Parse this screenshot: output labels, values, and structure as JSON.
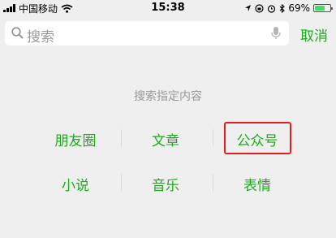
{
  "status_bar": {
    "carrier": "中国移动",
    "time": "15:38",
    "battery_percent": "69%",
    "battery_level": 0.69
  },
  "search": {
    "placeholder": "搜索",
    "cancel_label": "取消"
  },
  "hint": "搜索指定内容",
  "options": [
    "朋友圈",
    "文章",
    "公众号",
    "小说",
    "音乐",
    "表情"
  ],
  "highlighted_option": "公众号",
  "colors": {
    "accent": "#1aad19",
    "highlight_border": "#e02020",
    "background": "#efefef"
  }
}
